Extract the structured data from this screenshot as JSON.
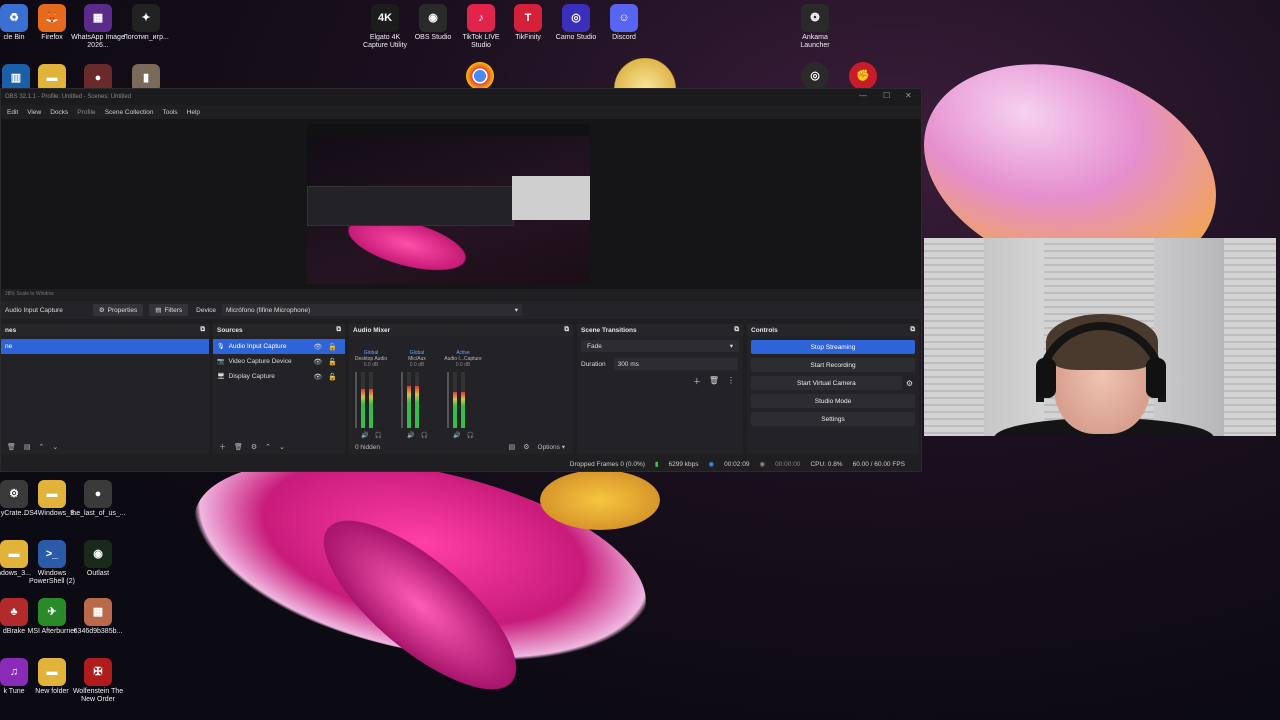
{
  "desktop": {
    "top_icons": [
      {
        "label": "cle Bin",
        "icon": "recycle-bin-icon",
        "color": "#3b6fd1",
        "glyph": "♻"
      },
      {
        "label": "Firefox",
        "icon": "firefox-icon",
        "color": "#e66a1d",
        "glyph": "🦊"
      },
      {
        "label": "WhatsApp Image 2026...",
        "icon": "image-file-icon",
        "color": "#5a2b8a",
        "glyph": "▦"
      },
      {
        "label": "Логотип_игр...",
        "icon": "logo-file-icon",
        "color": "#222222",
        "glyph": "✦"
      },
      {
        "label": "Elgato 4K Capture Utility",
        "icon": "elgato-icon",
        "color": "#1c1c1c",
        "glyph": "4K"
      },
      {
        "label": "OBS Studio",
        "icon": "obs-icon",
        "color": "#2a2a2a",
        "glyph": "◉"
      },
      {
        "label": "TikTok LIVE Studio",
        "icon": "tiktok-icon",
        "color": "#e0244b",
        "glyph": "♪"
      },
      {
        "label": "TikFinity",
        "icon": "tikfinity-icon",
        "color": "#d42038",
        "glyph": "T"
      },
      {
        "label": "Camo Studio",
        "icon": "camo-icon",
        "color": "#3a2fb8",
        "glyph": "◎"
      },
      {
        "label": "Discord",
        "icon": "discord-icon",
        "color": "#5865f2",
        "glyph": "☺"
      },
      {
        "label": "Ankama Launcher",
        "icon": "ankama-icon",
        "color": "#2a2a2a",
        "glyph": "❂"
      }
    ],
    "left_icons": [
      {
        "label": "yCrate...",
        "icon": "gear-app-icon",
        "color": "#3a3a3a",
        "glyph": "⚙"
      },
      {
        "label": "DS4Windows_3...",
        "icon": "folder-icon",
        "color": "#e2b33a",
        "glyph": "▬"
      },
      {
        "label": "the_last_of_us_...",
        "icon": "game-file-icon",
        "color": "#3a3a3a",
        "glyph": "●"
      },
      {
        "label": "ndows_3...",
        "icon": "folder-icon",
        "color": "#e2b33a",
        "glyph": "▬"
      },
      {
        "label": "Windows PowerShell (2)",
        "icon": "powershell-icon",
        "color": "#2a5aa8",
        "glyph": ">_"
      },
      {
        "label": "Outlast",
        "icon": "outlast-icon",
        "color": "#1a2a1a",
        "glyph": "◉"
      },
      {
        "label": "dBrake",
        "icon": "handbrake-icon",
        "color": "#b32a2a",
        "glyph": "♣"
      },
      {
        "label": "MSI Afterburner",
        "icon": "afterburner-icon",
        "color": "#2a8a2a",
        "glyph": "✈"
      },
      {
        "label": "6346d9b385b...",
        "icon": "photo-file-icon",
        "color": "#b86a4a",
        "glyph": "▦"
      },
      {
        "label": "k Tune",
        "icon": "tune-app-icon",
        "color": "#8a2ab8",
        "glyph": "♫"
      },
      {
        "label": "New folder",
        "icon": "folder-icon",
        "color": "#e2b33a",
        "glyph": "▬"
      },
      {
        "label": "Wolfenstein The New Order",
        "icon": "wolfenstein-icon",
        "color": "#b01c1c",
        "glyph": "✠"
      }
    ]
  },
  "obs": {
    "title": "OBS 32.1.1 - Profile: Untitled - Scenes: Untitled",
    "menu": [
      "Edit",
      "View",
      "Docks",
      "Profile",
      "Scene Collection",
      "Tools",
      "Help"
    ],
    "zoom_label": "28%   Scale to Window",
    "source_toolbar": {
      "selected_source": "Audio Input Capture",
      "properties": "Properties",
      "filters": "Filters",
      "device_label": "Device",
      "device_value": "Micrófono (fifine Microphone)"
    },
    "scenes": {
      "title": "nes",
      "selected": "ne"
    },
    "sources": {
      "title": "Sources",
      "items": [
        "Audio Input Capture",
        "Video Capture Device",
        "Display Capture"
      ]
    },
    "mixer": {
      "title": "Audio Mixer",
      "channels": [
        {
          "tag": "Global",
          "name": "Desktop Audio",
          "db": "0.0 dB",
          "level": 0.7
        },
        {
          "tag": "Global",
          "name": "Mic/Aux",
          "db": "0.0 dB",
          "level": 0.75
        },
        {
          "tag": "Active",
          "name": "Audio I...Capture",
          "db": "0.0 dB",
          "level": 0.65
        }
      ],
      "hidden": "0 hidden",
      "options": "Options"
    },
    "transitions": {
      "title": "Scene Transitions",
      "type": "Fade",
      "duration_label": "Duration",
      "duration_value": "300 ms"
    },
    "controls": {
      "title": "Controls",
      "buttons": [
        "Stop Streaming",
        "Start Recording",
        "Start Virtual Camera",
        "Studio Mode",
        "Settings"
      ]
    },
    "status": {
      "dropped": "Dropped Frames 0 (0.0%)",
      "bitrate": "6299 kbps",
      "stream_time": "00:02:09",
      "rec_time": "00:00:00",
      "cpu": "CPU: 0.8%",
      "fps": "60.00 / 60.00 FPS"
    },
    "accent": "#2f64d8"
  }
}
